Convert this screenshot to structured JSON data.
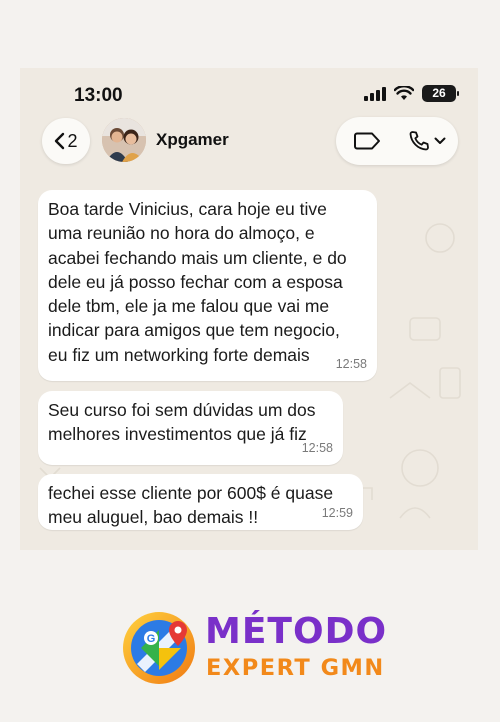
{
  "status_bar": {
    "time": "13:00",
    "battery_level": "26",
    "icons": [
      "signal-icon",
      "wifi-icon",
      "battery-icon"
    ]
  },
  "header": {
    "back_count": "2",
    "contact_name": "Xpgamer",
    "icons": [
      "back-chevron-icon",
      "avatar",
      "label-icon",
      "phone-icon",
      "chevron-down-icon"
    ]
  },
  "messages": [
    {
      "text": "Boa tarde Vinicius, cara hoje eu tive\numa reunião no hora do almoço, e\nacabei fechando mais um cliente, e do\ndele eu já posso fechar com a esposa\ndele tbm, ele ja me falou que vai me\nindicar para amigos que tem negocio,\neu fiz um networking forte demais",
      "time": "12:58"
    },
    {
      "text": "Seu curso foi sem dúvidas um dos\nmelhores investimentos que já fiz",
      "time": "12:58"
    },
    {
      "text": "fechei esse cliente por 600$ é quase\nmeu aluguel, bao demais !!",
      "time": "12:59"
    }
  ],
  "brand": {
    "line1": "MÉTODO",
    "line2": "EXPERT GMN",
    "colors": {
      "primary": "#7a30c9",
      "secondary": "#f2891a"
    },
    "logo_icon": "map-pin-logo-icon"
  },
  "colors": {
    "chat_background": "#efeae2",
    "bubble": "#ffffff",
    "page_background": "#f4f2ef"
  }
}
